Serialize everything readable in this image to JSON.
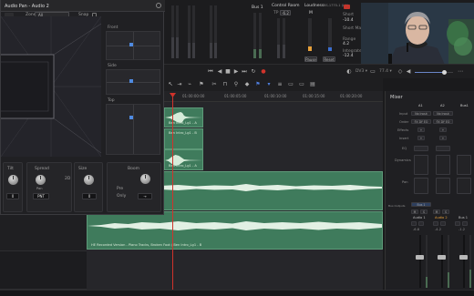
{
  "pan_window": {
    "title": "Audio Pan - Audio 2",
    "zone_label": "Zone",
    "zone_value": "All",
    "snap_label": "Snap",
    "views": [
      "Front",
      "Side",
      "Top"
    ],
    "knobs": [
      {
        "label": "Tilt",
        "value": "0"
      },
      {
        "label": "Spread",
        "value": "PNT",
        "sub": "Pan"
      },
      {
        "label": "2D",
        "value": ""
      },
      {
        "label": "Size",
        "value": "0"
      },
      {
        "label": "Boom",
        "value": "→",
        "sub1": "Pre",
        "sub2": "Only"
      }
    ]
  },
  "meters": {
    "bus_label": "Bus 1",
    "control_room_label": "Control Room",
    "tp_label": "TP",
    "tp_value": "-6.2",
    "m_label": "M",
    "loudness_label": "Loudness",
    "loudness_standard": "BS.1770-1 (LU)",
    "short_label": "Short",
    "short_value": "-10.4",
    "short_max_label": "Short Max",
    "range_label": "Range",
    "range_value": "4.2",
    "integrated_label": "Integrated",
    "integrated_value": "-12.4",
    "pause_label": "Pause",
    "reset_label": "Reset"
  },
  "transport": {
    "timecode_options": "DV3 ▾",
    "zoom_value": "77.4 ▾"
  },
  "ruler": {
    "timecodes": [
      "01:00:00:00",
      "01:00:05:00",
      "01:00:10:00",
      "01:00:15:00",
      "01:00:20:00"
    ]
  },
  "clips": {
    "clip_a1": "Ben Intro_Lg1 - A",
    "clip_a2": "Ben Intro_Lg1 - B",
    "clip_a3": "Ben Intro_Lg1 - A",
    "clip_long1": "Ben Intro_Lg1 - A",
    "clip_long2": "HE Recorded Version - Piano Tracks, Broken Foot / Ben Intro_Lg1 - B"
  },
  "mixer": {
    "title": "Mixer",
    "channels": [
      "A1",
      "A2",
      "Bus1"
    ],
    "row_labels": [
      "Input",
      "Order",
      "Effects",
      "Insert",
      "EQ",
      "Dynamics",
      "Pan",
      "Bus Outputs"
    ],
    "input_values": [
      "No Input",
      "No Input"
    ],
    "order_values": [
      "FX DY EQ",
      "FX DY EQ"
    ],
    "bus_output_value": "Bus 1",
    "channel_names": [
      "Audio 1",
      "Audio 2",
      "Bus 1"
    ],
    "fader_values": [
      "0.0",
      "0.0",
      "0.0"
    ],
    "level_values": [
      "-6.8",
      "-4.2",
      "-1.2"
    ]
  },
  "colors": {
    "clip_green": "#3f7b5c",
    "playhead": "#d0332b",
    "accent_orange": "#e8a13a",
    "meter_green": "#66c07a"
  }
}
